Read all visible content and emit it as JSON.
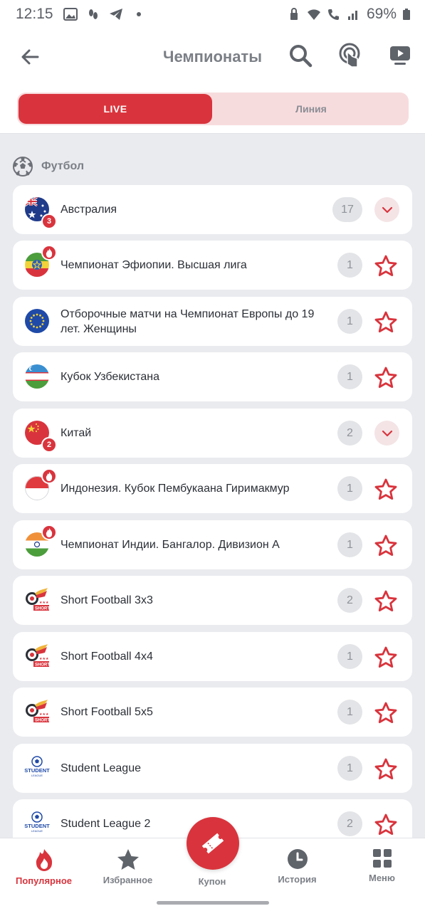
{
  "status_bar": {
    "time": "12:15",
    "battery": "69%"
  },
  "header": {
    "title": "Чемпионаты",
    "back_icon": "arrow-left-icon",
    "search_icon": "search-icon",
    "touch_icon": "touch-icon",
    "video_icon": "video-icon"
  },
  "tabs": {
    "live_label": "LIVE",
    "line_label": "Линия",
    "active": "LIVE"
  },
  "section": {
    "title": "Футбол",
    "icon": "soccer-ball-icon"
  },
  "rows": [
    {
      "label": "Австралия",
      "count": "17",
      "badge": "3",
      "action": "expand",
      "flag": "australia"
    },
    {
      "label": "Чемпионат Эфиопии. Высшая лига",
      "count": "1",
      "action": "star",
      "flag": "ethiopia",
      "hot": true
    },
    {
      "label": "Отборочные матчи на Чемпионат Европы до 19 лет. Женщины",
      "count": "1",
      "action": "star",
      "flag": "europe"
    },
    {
      "label": "Кубок Узбекистана",
      "count": "1",
      "action": "star",
      "flag": "uzbekistan"
    },
    {
      "label": "Китай",
      "count": "2",
      "badge": "2",
      "action": "expand",
      "flag": "china"
    },
    {
      "label": "Индонезия. Кубок Пембукаана Гиримакмур",
      "count": "1",
      "action": "star",
      "flag": "indonesia",
      "hot": true
    },
    {
      "label": "Чемпионат Индии. Бангалор. Дивизион А",
      "count": "1",
      "action": "star",
      "flag": "india",
      "hot": true
    },
    {
      "label": "Short Football 3x3",
      "count": "2",
      "action": "star",
      "flag": "short-football"
    },
    {
      "label": "Short Football 4x4",
      "count": "1",
      "action": "star",
      "flag": "short-football"
    },
    {
      "label": "Short Football 5x5",
      "count": "1",
      "action": "star",
      "flag": "short-football"
    },
    {
      "label": "Student League",
      "count": "1",
      "action": "star",
      "flag": "student-league"
    },
    {
      "label": "Student League 2",
      "count": "2",
      "action": "star",
      "flag": "student-league"
    }
  ],
  "bottom_nav": {
    "popular": "Популярное",
    "favorites": "Избранное",
    "coupon": "Купон",
    "history": "История",
    "menu": "Меню",
    "active": "popular"
  },
  "colors": {
    "accent": "#d9343d",
    "background": "#eaebef",
    "muted": "#7b7f86"
  }
}
